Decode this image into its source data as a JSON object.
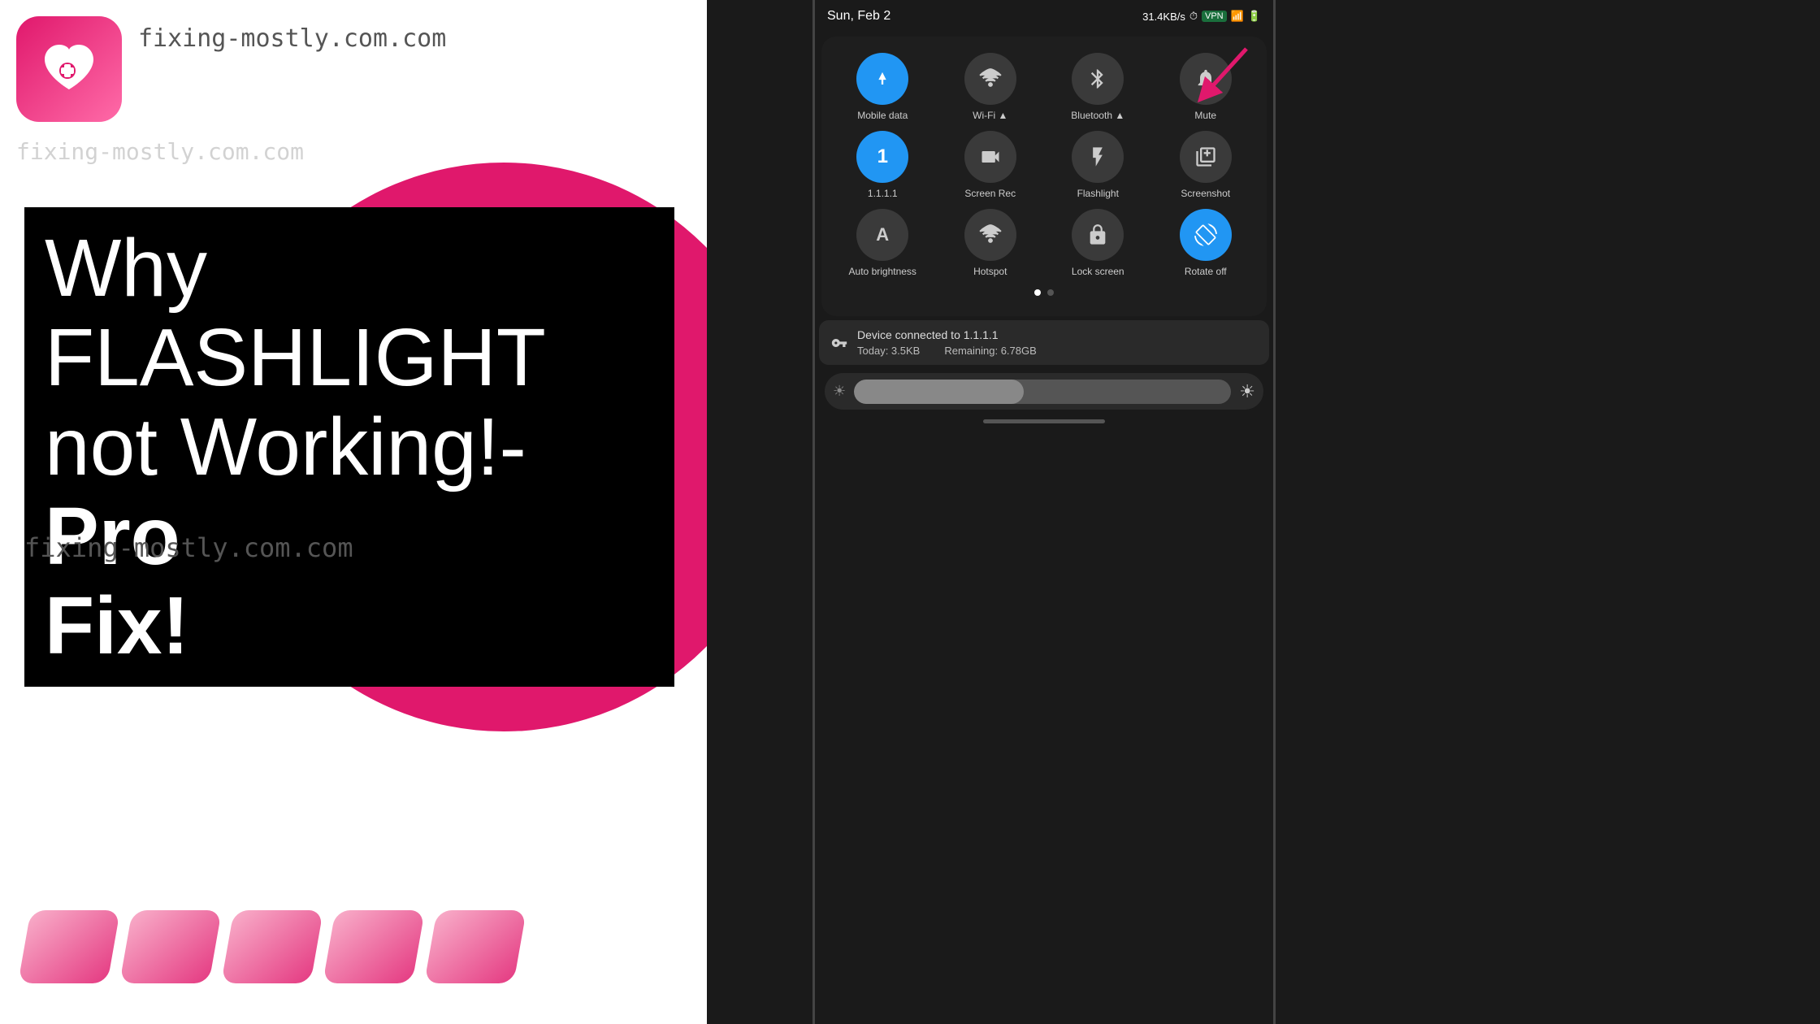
{
  "left": {
    "site_url_top": "fixing-mostly.com.com",
    "site_url_watermark": "fixing-mostly.com.com",
    "headline_line1": "Why FLASHLIGHT",
    "headline_line2": "not Working!- ",
    "headline_bold": "Pro",
    "headline_line3": "Fix!",
    "site_url_bottom": "fixing-mostly.com.com"
  },
  "phone": {
    "status_date": "Sun, Feb 2",
    "status_info": "31.4KB/s",
    "tiles": [
      {
        "label": "Mobile data",
        "icon": "↕",
        "active": true
      },
      {
        "label": "Wi-Fi ▲",
        "icon": "wifi",
        "active": false
      },
      {
        "label": "Bluetooth ▲",
        "icon": "bluetooth",
        "active": false
      },
      {
        "label": "Mute",
        "icon": "bell",
        "active": false
      },
      {
        "label": "1.1.1.1",
        "icon": "1",
        "active": true
      },
      {
        "label": "Screen Rec",
        "icon": "video",
        "active": false
      },
      {
        "label": "Flashlight",
        "icon": "flashlight",
        "active": false
      },
      {
        "label": "Screenshot",
        "icon": "screenshot",
        "active": false
      },
      {
        "label": "Auto brightness",
        "icon": "A",
        "active": false
      },
      {
        "label": "Hotspot",
        "icon": "hotspot",
        "active": false
      },
      {
        "label": "Lock screen",
        "icon": "lock",
        "active": false
      },
      {
        "label": "Rotate off",
        "icon": "rotate",
        "active": true
      }
    ],
    "vpn_connected": "Device connected to 1.1.1.1",
    "vpn_today": "Today: 3.5KB",
    "vpn_remaining": "Remaining: 6.78GB"
  }
}
